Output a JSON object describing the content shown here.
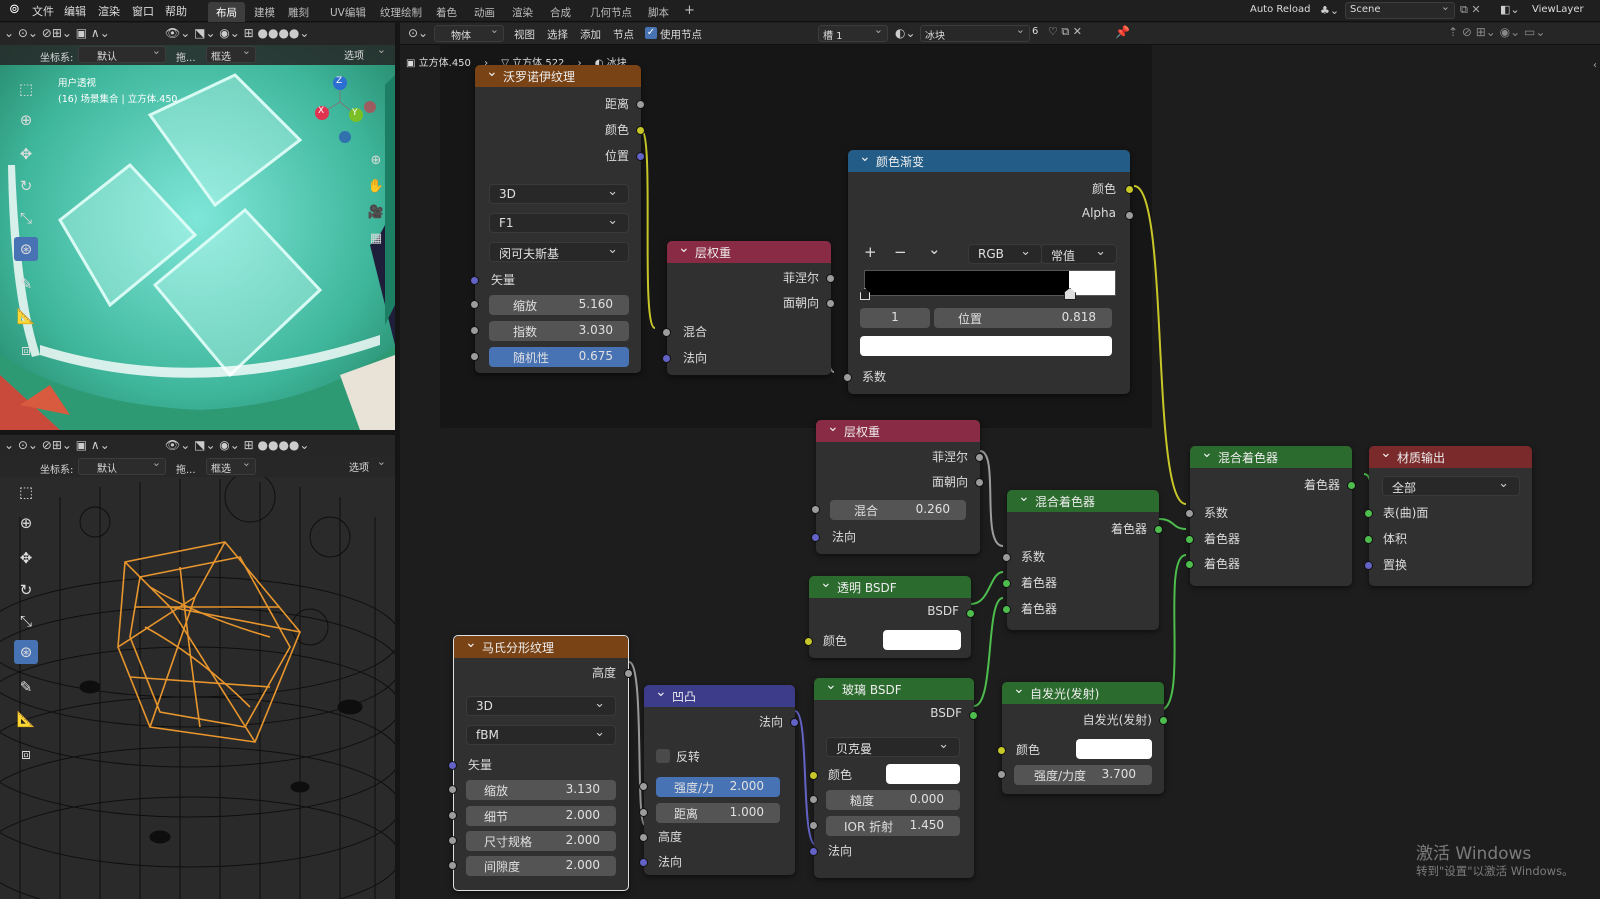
{
  "menubar": {
    "items": [
      "文件",
      "编辑",
      "渲染",
      "窗口",
      "帮助"
    ],
    "workspaces": [
      "布局",
      "建模",
      "雕刻",
      "UV编辑",
      "纹理绘制",
      "着色",
      "动画",
      "渲染",
      "合成",
      "几何节点",
      "脚本"
    ],
    "active_workspace": "布局",
    "add_tab": "+",
    "auto_reload": "Auto Reload",
    "scene": "Scene",
    "view_layer": "ViewLayer"
  },
  "node_header": {
    "object_mode": "物体",
    "menus": [
      "视图",
      "选择",
      "添加",
      "节点"
    ],
    "use_nodes": "使用节点",
    "slot": "槽 1",
    "material": "冰块",
    "users": "6"
  },
  "breadcrumb": [
    "立方体.450",
    "立方体.522",
    "冰块"
  ],
  "viewport1": {
    "coord_label": "坐标系:",
    "coord_value": "默认",
    "drag_label": "拖...",
    "select_mode": "框选",
    "options": "选项",
    "view_name": "用户透视",
    "collection_info": "(16) 场景集合 | 立方体.450",
    "axes": [
      "X",
      "Y",
      "Z"
    ]
  },
  "viewport2": {
    "coord_label": "坐标系:",
    "coord_value": "默认",
    "drag_label": "拖...",
    "select_mode": "框选",
    "options": "选项"
  },
  "nodes": {
    "voronoi": {
      "title": "沃罗诺伊纹理",
      "outputs": [
        "距离",
        "颜色",
        "位置"
      ],
      "dim": "3D",
      "feature": "F1",
      "metric": "闵可夫斯基",
      "vector": "矢量",
      "fields": [
        {
          "label": "缩放",
          "value": "5.160"
        },
        {
          "label": "指数",
          "value": "3.030"
        },
        {
          "label": "随机性",
          "value": "0.675"
        }
      ]
    },
    "layer_weight1": {
      "title": "层权重",
      "outputs": [
        "菲涅尔",
        "面朝向"
      ],
      "inputs": [
        "混合",
        "法向"
      ]
    },
    "color_ramp": {
      "title": "颜色渐变",
      "outputs": [
        "颜色",
        "Alpha"
      ],
      "plus": "+",
      "minus": "−",
      "chev": "⌄",
      "mode": "RGB",
      "interp": "常值",
      "stop_index": "1",
      "pos_label": "位置",
      "pos_value": "0.818",
      "stop_position": 0.818,
      "fac": "系数"
    },
    "layer_weight2": {
      "title": "层权重",
      "outputs": [
        "菲涅尔",
        "面朝向"
      ],
      "blend_label": "混合",
      "blend_value": "0.260",
      "normal": "法向"
    },
    "mix1": {
      "title": "混合着色器",
      "output": "着色器",
      "inputs": [
        "系数",
        "着色器",
        "着色器"
      ]
    },
    "mix2": {
      "title": "混合着色器",
      "output": "着色器",
      "inputs": [
        "系数",
        "着色器",
        "着色器"
      ]
    },
    "output": {
      "title": "材质输出",
      "target": "全部",
      "inputs": [
        "表(曲)面",
        "体积",
        "置换"
      ]
    },
    "transparent": {
      "title": "透明 BSDF",
      "output": "BSDF",
      "color": "颜色"
    },
    "glass": {
      "title": "玻璃 BSDF",
      "output": "BSDF",
      "distribution": "贝克曼",
      "color": "颜色",
      "rough_label": "糙度",
      "rough_value": "0.000",
      "ior_label": "IOR 折射",
      "ior_value": "1.450",
      "normal": "法向"
    },
    "emission": {
      "title": "自发光(发射)",
      "output": "自发光(发射)",
      "color": "颜色",
      "strength_label": "强度/力度",
      "strength_value": "3.700"
    },
    "bump": {
      "title": "凹凸",
      "output": "法向",
      "invert": "反转",
      "strength_label": "强度/力",
      "strength_value": "2.000",
      "distance_label": "距离",
      "distance_value": "1.000",
      "height": "高度",
      "normal": "法向"
    },
    "musgrave": {
      "title": "马氏分形纹理",
      "output": "高度",
      "dim": "3D",
      "type": "fBM",
      "vector": "矢量",
      "fields": [
        {
          "label": "缩放",
          "value": "3.130"
        },
        {
          "label": "细节",
          "value": "2.000"
        },
        {
          "label": "尺寸规格",
          "value": "2.000"
        },
        {
          "label": "间隙度",
          "value": "2.000"
        }
      ]
    }
  },
  "watermark": {
    "line1": "激活 Windows",
    "line2": "转到\"设置\"以激活 Windows。"
  }
}
